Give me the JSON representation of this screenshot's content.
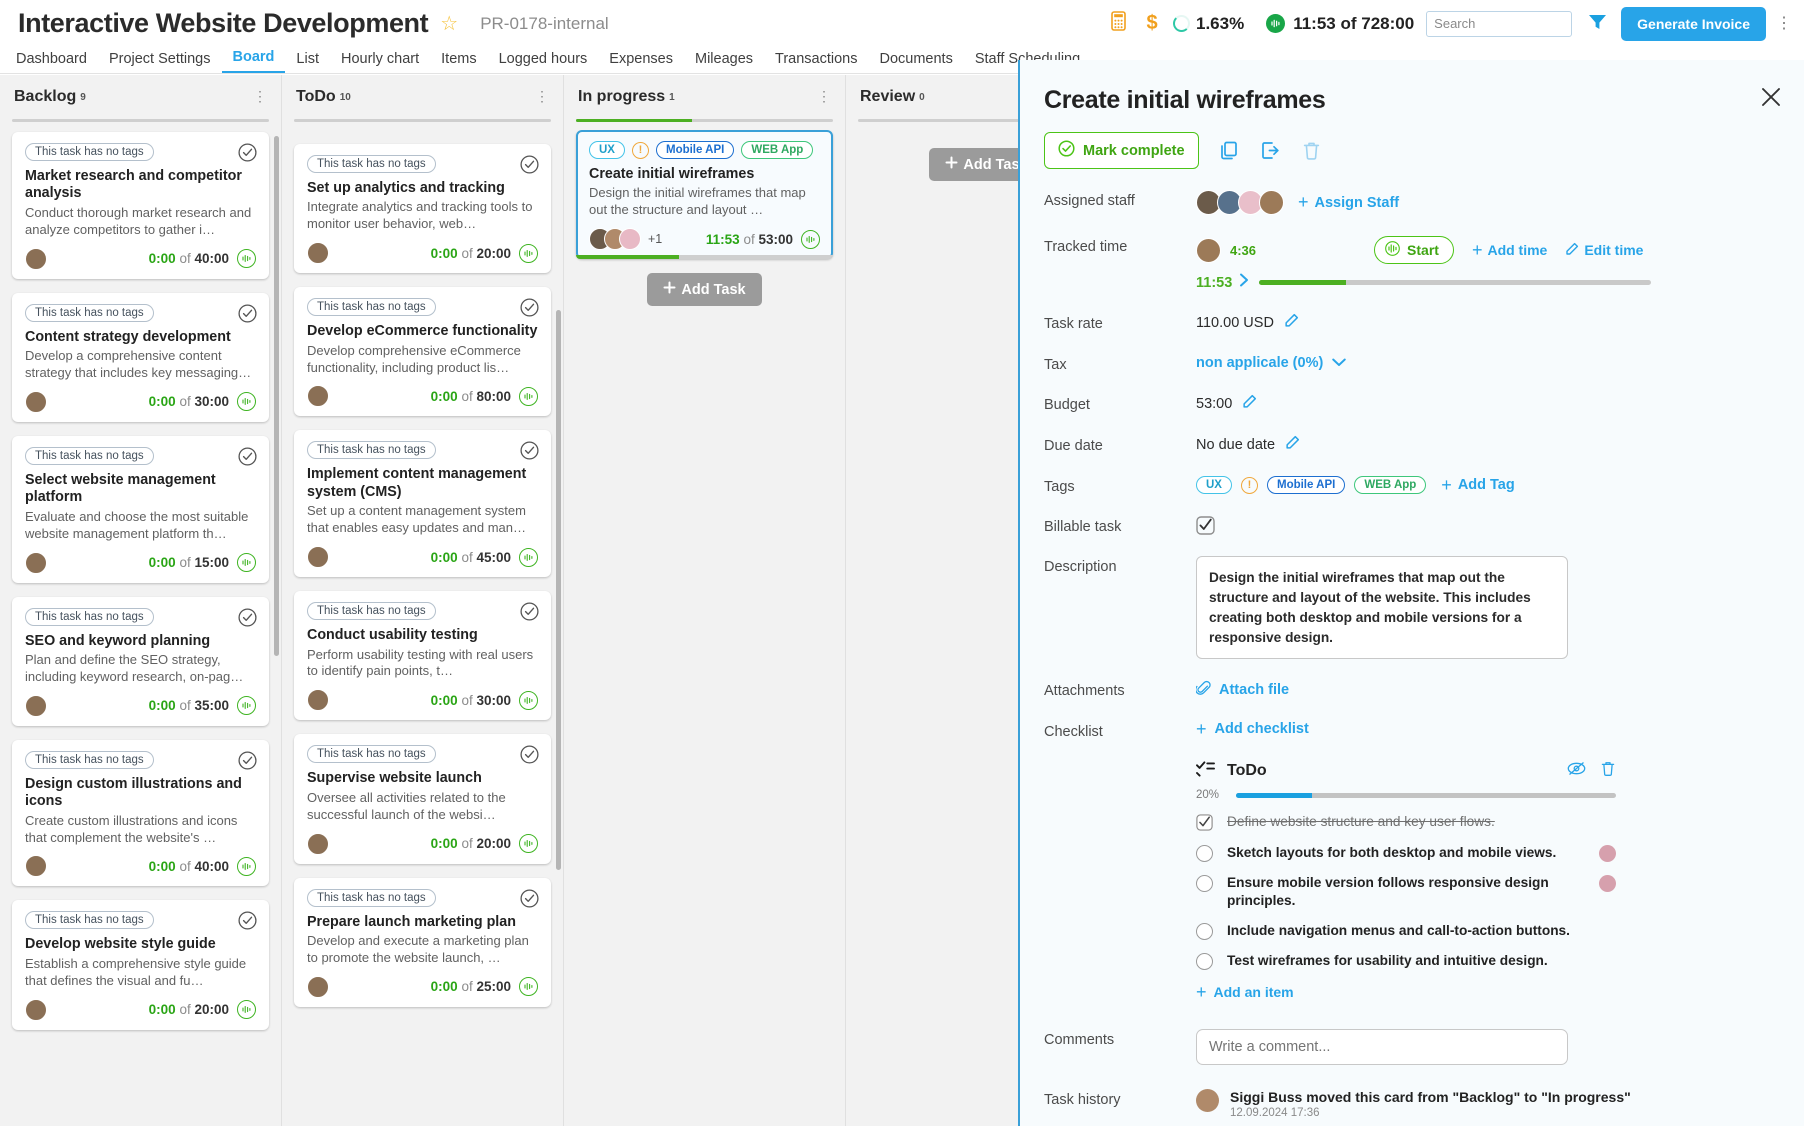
{
  "topbar": {
    "project_title": "Interactive Website Development",
    "star_icon": "star-icon",
    "project_code": "PR-0178-internal",
    "calculator_icon": "calculator-icon",
    "dollar_icon": "dollar-icon",
    "percent_value": "1.63%",
    "time_value": "11:53 of 728:00",
    "search_placeholder": "Search",
    "search_value": "",
    "filter_icon": "funnel-icon",
    "generate_invoice_label": "Generate Invoice",
    "overflow_icon": "kebab-menu-icon"
  },
  "nav": {
    "tabs": [
      {
        "label": "Dashboard",
        "active": false
      },
      {
        "label": "Project Settings",
        "active": false
      },
      {
        "label": "Board",
        "active": true
      },
      {
        "label": "List",
        "active": false
      },
      {
        "label": "Hourly chart",
        "active": false
      },
      {
        "label": "Items",
        "active": false
      },
      {
        "label": "Logged hours",
        "active": false
      },
      {
        "label": "Expenses",
        "active": false
      },
      {
        "label": "Mileages",
        "active": false
      },
      {
        "label": "Transactions",
        "active": false
      },
      {
        "label": "Documents",
        "active": false
      },
      {
        "label": "Staff Scheduling",
        "active": false
      }
    ]
  },
  "board": {
    "add_task_label": "Add Task",
    "no_tags_label": "This task has no tags",
    "columns": [
      {
        "name": "Backlog",
        "count": "9",
        "progress_pct": 0,
        "cards": [
          {
            "title": "Market research and competitor analysis",
            "desc": "Conduct thorough market research and analyze competitors to gather i…",
            "spent": "0:00",
            "of": "of",
            "budget": "40:00"
          },
          {
            "title": "Content strategy development",
            "desc": "Develop a comprehensive content strategy that includes key messaging…",
            "spent": "0:00",
            "of": "of",
            "budget": "30:00"
          },
          {
            "title": "Select website management platform",
            "desc": "Evaluate and choose the most suitable website management platform th…",
            "spent": "0:00",
            "of": "of",
            "budget": "15:00"
          },
          {
            "title": "SEO and keyword planning",
            "desc": "Plan and define the SEO strategy, including keyword research, on-pag…",
            "spent": "0:00",
            "of": "of",
            "budget": "35:00"
          },
          {
            "title": "Design custom illustrations and icons",
            "desc": "Create custom illustrations and icons that complement the website's …",
            "spent": "0:00",
            "of": "of",
            "budget": "40:00"
          },
          {
            "title": "Develop website style guide",
            "desc": "Establish a comprehensive style guide that defines the visual and fu…",
            "spent": "0:00",
            "of": "of",
            "budget": "20:00"
          }
        ]
      },
      {
        "name": "ToDo",
        "count": "10",
        "progress_pct": 0,
        "cards": [
          {
            "title": "Set up analytics and tracking",
            "desc": "Integrate analytics and tracking tools to monitor user behavior, web…",
            "spent": "0:00",
            "of": "of",
            "budget": "20:00"
          },
          {
            "title": "Develop eCommerce functionality",
            "desc": "Develop comprehensive eCommerce functionality, including product lis…",
            "spent": "0:00",
            "of": "of",
            "budget": "80:00"
          },
          {
            "title": "Implement content management system (CMS)",
            "desc": "Set up a content management system that enables easy updates and man…",
            "spent": "0:00",
            "of": "of",
            "budget": "45:00"
          },
          {
            "title": "Conduct usability testing",
            "desc": "Perform usability testing with real users to identify pain points, t…",
            "spent": "0:00",
            "of": "of",
            "budget": "30:00"
          },
          {
            "title": "Supervise website launch",
            "desc": "Oversee all activities related to the successful launch of the websi…",
            "spent": "0:00",
            "of": "of",
            "budget": "20:00"
          },
          {
            "title": "Prepare launch marketing plan",
            "desc": "Develop and execute a marketing plan to promote the website launch, …",
            "spent": "0:00",
            "of": "of",
            "budget": "25:00"
          }
        ]
      },
      {
        "name": "In progress",
        "count": "1",
        "progress_pct": 45,
        "cards": [
          {
            "title": "Create initial wireframes",
            "desc": "Design the initial wireframes that map out the structure and layout …",
            "spent": "11:53",
            "of": "of",
            "budget": "53:00",
            "tags": [
              "UX",
              "Mobile API",
              "WEB App"
            ],
            "extra_assignees": "+1",
            "progress_pct": 40,
            "selected": true
          }
        ]
      },
      {
        "name": "Review",
        "count": "0",
        "progress_pct": 0,
        "cards": []
      }
    ]
  },
  "panel": {
    "title": "Create initial wireframes",
    "close_icon": "close-icon",
    "mark_complete_label": "Mark complete",
    "copy_icon": "copy-icon",
    "move_icon": "move-out-icon",
    "delete_icon": "trash-icon",
    "labels": {
      "assigned_staff": "Assigned staff",
      "tracked_time": "Tracked time",
      "task_rate": "Task rate",
      "tax": "Tax",
      "budget": "Budget",
      "due_date": "Due date",
      "tags": "Tags",
      "billable_task": "Billable task",
      "description": "Description",
      "attachments": "Attachments",
      "checklist": "Checklist",
      "comments": "Comments",
      "task_history": "Task history"
    },
    "assign_staff_label": "Assign Staff",
    "tracked_user_time": "4:36",
    "start_label": "Start",
    "add_time_label": "Add time",
    "edit_time_label": "Edit time",
    "time_progress_value": "11:53",
    "time_progress_pct": 22,
    "task_rate": "110.00 USD",
    "tax": "non applicale (0%)",
    "budget": "53:00",
    "due_date": "No due date",
    "tags": [
      "UX",
      "Mobile API",
      "WEB App"
    ],
    "add_tag_label": "Add Tag",
    "description": "Design the initial wireframes that map out the structure and layout of the website. This includes creating both desktop and mobile versions for a responsive design.",
    "attach_file_label": "Attach file",
    "add_checklist_label": "Add checklist",
    "checklist": {
      "name": "ToDo",
      "percent": "20%",
      "percent_value": 20,
      "hide_icon": "eye-off-icon",
      "delete_icon": "trash-icon",
      "items": [
        {
          "text": "Define website structure and key user flows.",
          "done": true,
          "avatar": false
        },
        {
          "text": "Sketch layouts for both desktop and mobile views.",
          "done": false,
          "avatar": true
        },
        {
          "text": "Ensure mobile version follows responsive design principles.",
          "done": false,
          "avatar": true
        },
        {
          "text": "Include navigation menus and call-to-action buttons.",
          "done": false,
          "avatar": false
        },
        {
          "text": "Test wireframes for usability and intuitive design.",
          "done": false,
          "avatar": false
        }
      ],
      "add_item_label": "Add an item"
    },
    "comment_placeholder": "Write a comment...",
    "history": {
      "text": "Siggi Buss moved this card from \"Backlog\" to \"In progress\"",
      "date": "12.09.2024 17:36"
    }
  },
  "colors": {
    "accent_blue": "#28a4e8",
    "green": "#4caf22",
    "orange": "#f1a01e",
    "panel_bg": "#f7fbfd"
  }
}
